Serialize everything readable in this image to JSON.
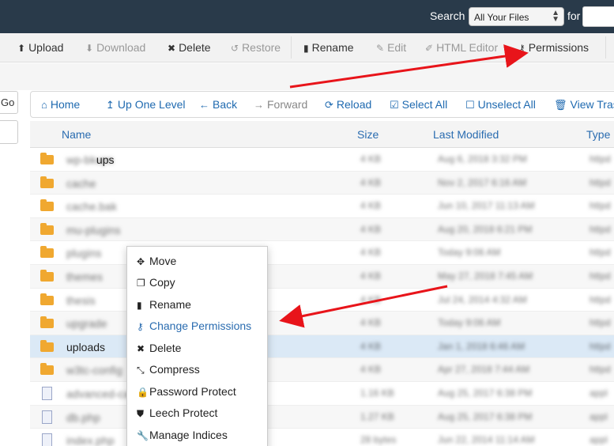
{
  "topbar": {
    "search_label": "Search",
    "scope_value": "All Your Files",
    "for_label": "for"
  },
  "toolbar": {
    "upload": "Upload",
    "download": "Download",
    "delete": "Delete",
    "restore": "Restore",
    "rename": "Rename",
    "edit": "Edit",
    "html_editor": "HTML Editor",
    "permissions": "Permissions"
  },
  "sidebar": {
    "go_label": "Go"
  },
  "navbar": {
    "home": "Home",
    "up_one_level": "Up One Level",
    "back": "Back",
    "forward": "Forward",
    "reload": "Reload",
    "select_all": "Select All",
    "unselect_all": "Unselect All",
    "view_trash": "View Trash"
  },
  "table": {
    "headers": {
      "name": "Name",
      "size": "Size",
      "last_modified": "Last Modified",
      "type": "Type"
    },
    "rows": [
      {
        "kind": "folder",
        "name_visible": "ups",
        "name_blurred": "wp-bkups",
        "size": "4 KB",
        "modified": "Aug 6, 2018 3:32 PM",
        "type": "httpd"
      },
      {
        "kind": "folder",
        "name_blurred": "cache",
        "size": "4 KB",
        "modified": "Nov 2, 2017 6:16 AM",
        "type": "httpd"
      },
      {
        "kind": "folder",
        "name_blurred": "cache.bak",
        "size": "4 KB",
        "modified": "Jun 10, 2017 11:13 AM",
        "type": "httpd"
      },
      {
        "kind": "folder",
        "name_blurred": "mu-plugins",
        "size": "4 KB",
        "modified": "Aug 20, 2018 6:21 PM",
        "type": "httpd"
      },
      {
        "kind": "folder",
        "name_blurred": "plugins",
        "size": "4 KB",
        "modified": "Today 9:06 AM",
        "type": "httpd"
      },
      {
        "kind": "folder",
        "name_blurred": "themes",
        "size": "4 KB",
        "modified": "May 27, 2018 7:45 AM",
        "type": "httpd"
      },
      {
        "kind": "folder",
        "name_blurred": "thesis",
        "size": "4 KB",
        "modified": "Jul 24, 2014 4:32 AM",
        "type": "httpd"
      },
      {
        "kind": "folder",
        "name_blurred": "upgrade",
        "size": "4 KB",
        "modified": "Today 9:06 AM",
        "type": "httpd"
      },
      {
        "kind": "folder",
        "name": "uploads",
        "size": "4 KB",
        "modified": "Jan 1, 2018 6:46 AM",
        "type": "httpd"
      },
      {
        "kind": "folder",
        "name_blurred": "w3tc-config",
        "size": "4 KB",
        "modified": "Apr 27, 2018 7:44 AM",
        "type": "httpd"
      },
      {
        "kind": "file",
        "name_blurred": "advanced-cache.php",
        "size": "1.16 KB",
        "modified": "Aug 25, 2017 6:38 PM",
        "type": "appl"
      },
      {
        "kind": "file",
        "name_blurred": "db.php",
        "size": "1.27 KB",
        "modified": "Aug 25, 2017 6:38 PM",
        "type": "appl"
      },
      {
        "kind": "file",
        "name_blurred": "index.php",
        "size": "28 bytes",
        "modified": "Jun 22, 2014 11:14 AM",
        "type": "appl"
      }
    ]
  },
  "context_menu": {
    "move": "Move",
    "copy": "Copy",
    "rename": "Rename",
    "change_permissions": "Change Permissions",
    "delete": "Delete",
    "compress": "Compress",
    "password_protect": "Password Protect",
    "leech_protect": "Leech Protect",
    "manage_indices": "Manage Indices"
  },
  "colors": {
    "topbar_bg": "#293a4a",
    "link_blue": "#2a6cb0",
    "folder": "#f0a830",
    "selected_row": "#dbe9f6",
    "annotation_arrow": "#e8141a"
  }
}
